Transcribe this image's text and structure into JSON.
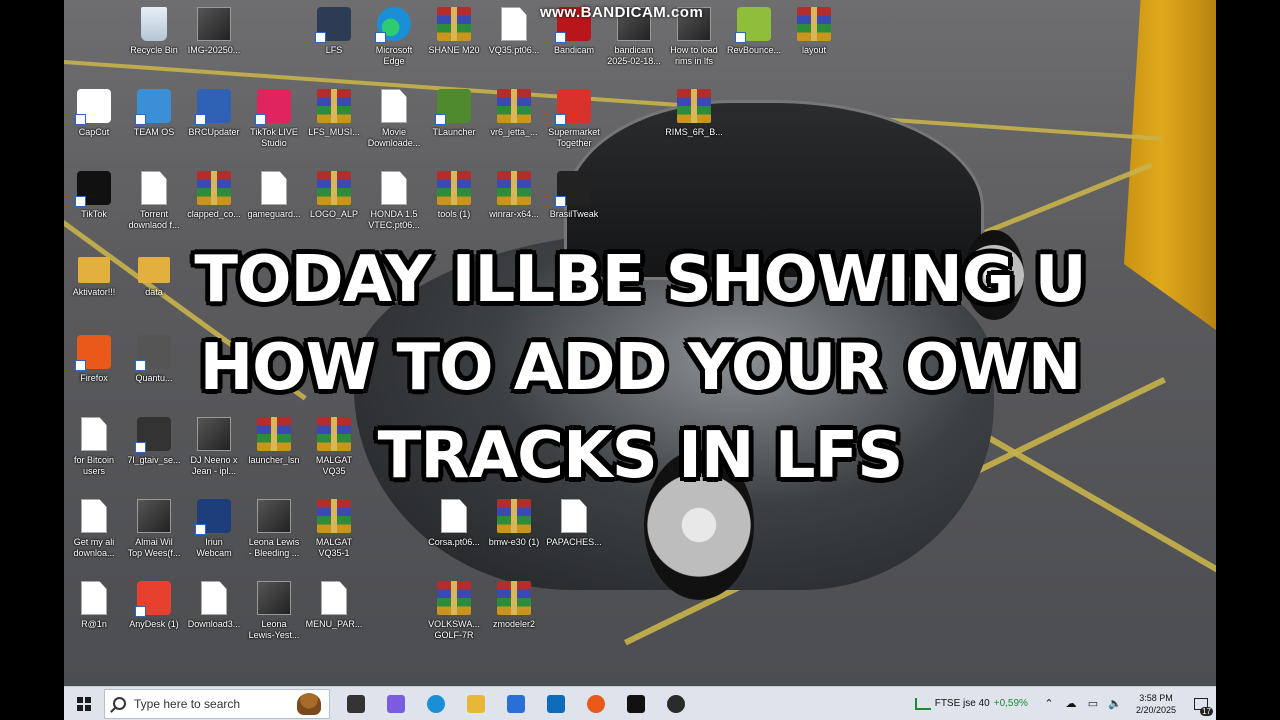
{
  "watermark": "www.BANDICAM.com",
  "overlay": {
    "lines": [
      "TODAY ILLBE SHOWING U",
      "HOW TO ADD YOUR OWN",
      "TRACKS IN LFS"
    ]
  },
  "desktop_icons": [
    {
      "label": "Recycle Bin",
      "kind": "recycle"
    },
    {
      "label": "IMG-20250...",
      "kind": "image"
    },
    {
      "label": "LFS",
      "kind": "app",
      "color": "#2e3b55"
    },
    {
      "label": "Microsoft\nEdge",
      "kind": "edge"
    },
    {
      "label": "SHANE M20",
      "kind": "rar"
    },
    {
      "label": "VQ35.pt06...",
      "kind": "doc"
    },
    {
      "label": "Bandicam",
      "kind": "app",
      "color": "#b8161b"
    },
    {
      "label": "bandicam\n2025-02-18...",
      "kind": "image"
    },
    {
      "label": "How to load\nrims in lfs",
      "kind": "image"
    },
    {
      "label": "RevBounce...",
      "kind": "app",
      "color": "#8fbf3a"
    },
    {
      "label": "layout",
      "kind": "rar"
    },
    {
      "label": "CapCut",
      "kind": "app",
      "color": "#ffffff"
    },
    {
      "label": "TEAM OS",
      "kind": "app",
      "color": "#3a8fd6"
    },
    {
      "label": "BRCUpdater",
      "kind": "app",
      "color": "#2f62b5"
    },
    {
      "label": "TikTok LIVE\nStudio",
      "kind": "app",
      "color": "#e0245e"
    },
    {
      "label": "LFS_MUSI...",
      "kind": "rar"
    },
    {
      "label": "Movie\nDownloade...",
      "kind": "doc"
    },
    {
      "label": "TLauncher",
      "kind": "app",
      "color": "#4f8a2e"
    },
    {
      "label": "vr6_jetta_...",
      "kind": "rar"
    },
    {
      "label": "Supermarket\nTogether",
      "kind": "app",
      "color": "#d9312b"
    },
    {
      "label": "RIMS_6R_B...",
      "kind": "rar"
    },
    {
      "label": "TikTok",
      "kind": "app",
      "color": "#111111"
    },
    {
      "label": "Torrent\ndownlaod f...",
      "kind": "doc"
    },
    {
      "label": "clapped_co...",
      "kind": "rar"
    },
    {
      "label": "gameguard...",
      "kind": "doc"
    },
    {
      "label": "LOGO_ALP",
      "kind": "rar"
    },
    {
      "label": "HONDA 1.5\nVTEC.pt06...",
      "kind": "doc"
    },
    {
      "label": "tools (1)",
      "kind": "rar"
    },
    {
      "label": "winrar-x64...",
      "kind": "rar"
    },
    {
      "label": "BrasilTweak",
      "kind": "app",
      "color": "#222222"
    },
    {
      "label": "Aktivator!!!",
      "kind": "folder"
    },
    {
      "label": "data",
      "kind": "folder"
    },
    {
      "label": "Firefox",
      "kind": "app",
      "color": "#e8591a"
    },
    {
      "label": "Quantu...",
      "kind": "app",
      "color": "#555555"
    },
    {
      "label": "for Bitcoin\nusers",
      "kind": "doc"
    },
    {
      "label": "7l_gtaiv_se...",
      "kind": "app",
      "color": "#333333"
    },
    {
      "label": "DJ Neeno x\nJean - ipl...",
      "kind": "image"
    },
    {
      "label": "launcher_lsn",
      "kind": "rar"
    },
    {
      "label": "MALGAT\nVQ35",
      "kind": "rar"
    },
    {
      "label": "Get my ali\ndownloa...",
      "kind": "doc"
    },
    {
      "label": "Almai Wil\nTop Wees(f...",
      "kind": "image"
    },
    {
      "label": "Iriun\nWebcam",
      "kind": "app",
      "color": "#1d3e7a"
    },
    {
      "label": "Leona Lewis\n- Bleeding ...",
      "kind": "image"
    },
    {
      "label": "MALGAT\nVQ35-1",
      "kind": "rar"
    },
    {
      "label": "Corsa.pt06...",
      "kind": "doc"
    },
    {
      "label": "bmw-e30 (1)",
      "kind": "rar"
    },
    {
      "label": "PAPACHES...",
      "kind": "doc"
    },
    {
      "label": "R@1n",
      "kind": "doc"
    },
    {
      "label": "AnyDesk (1)",
      "kind": "app",
      "color": "#e8402e"
    },
    {
      "label": "Download3...",
      "kind": "doc"
    },
    {
      "label": "Leona\nLewis-Yest...",
      "kind": "image"
    },
    {
      "label": "MENU_PAR...",
      "kind": "doc"
    },
    {
      "label": "VOLKSWA...\nGOLF-7R",
      "kind": "rar"
    },
    {
      "label": "zmodeler2",
      "kind": "rar"
    }
  ],
  "taskbar": {
    "search_placeholder": "Type here to search",
    "pinned": [
      {
        "name": "task-view-icon",
        "color": "#333333"
      },
      {
        "name": "copilot-icon",
        "color": "#7b5ce0"
      },
      {
        "name": "edge-icon",
        "color": "#1a8fd6"
      },
      {
        "name": "file-explorer-icon",
        "color": "#e8b737"
      },
      {
        "name": "store-icon",
        "color": "#2a6fd8"
      },
      {
        "name": "outlook-icon",
        "color": "#0f6cbd"
      },
      {
        "name": "firefox-icon",
        "color": "#e8591a"
      },
      {
        "name": "tiktok-icon",
        "color": "#111111"
      },
      {
        "name": "obs-icon",
        "color": "#2b2b2b"
      }
    ],
    "stock_name": "FTSE jse 40",
    "stock_change": "+0,59%",
    "time": "3:58 PM",
    "date": "2/20/2025",
    "notification_count": "17"
  }
}
